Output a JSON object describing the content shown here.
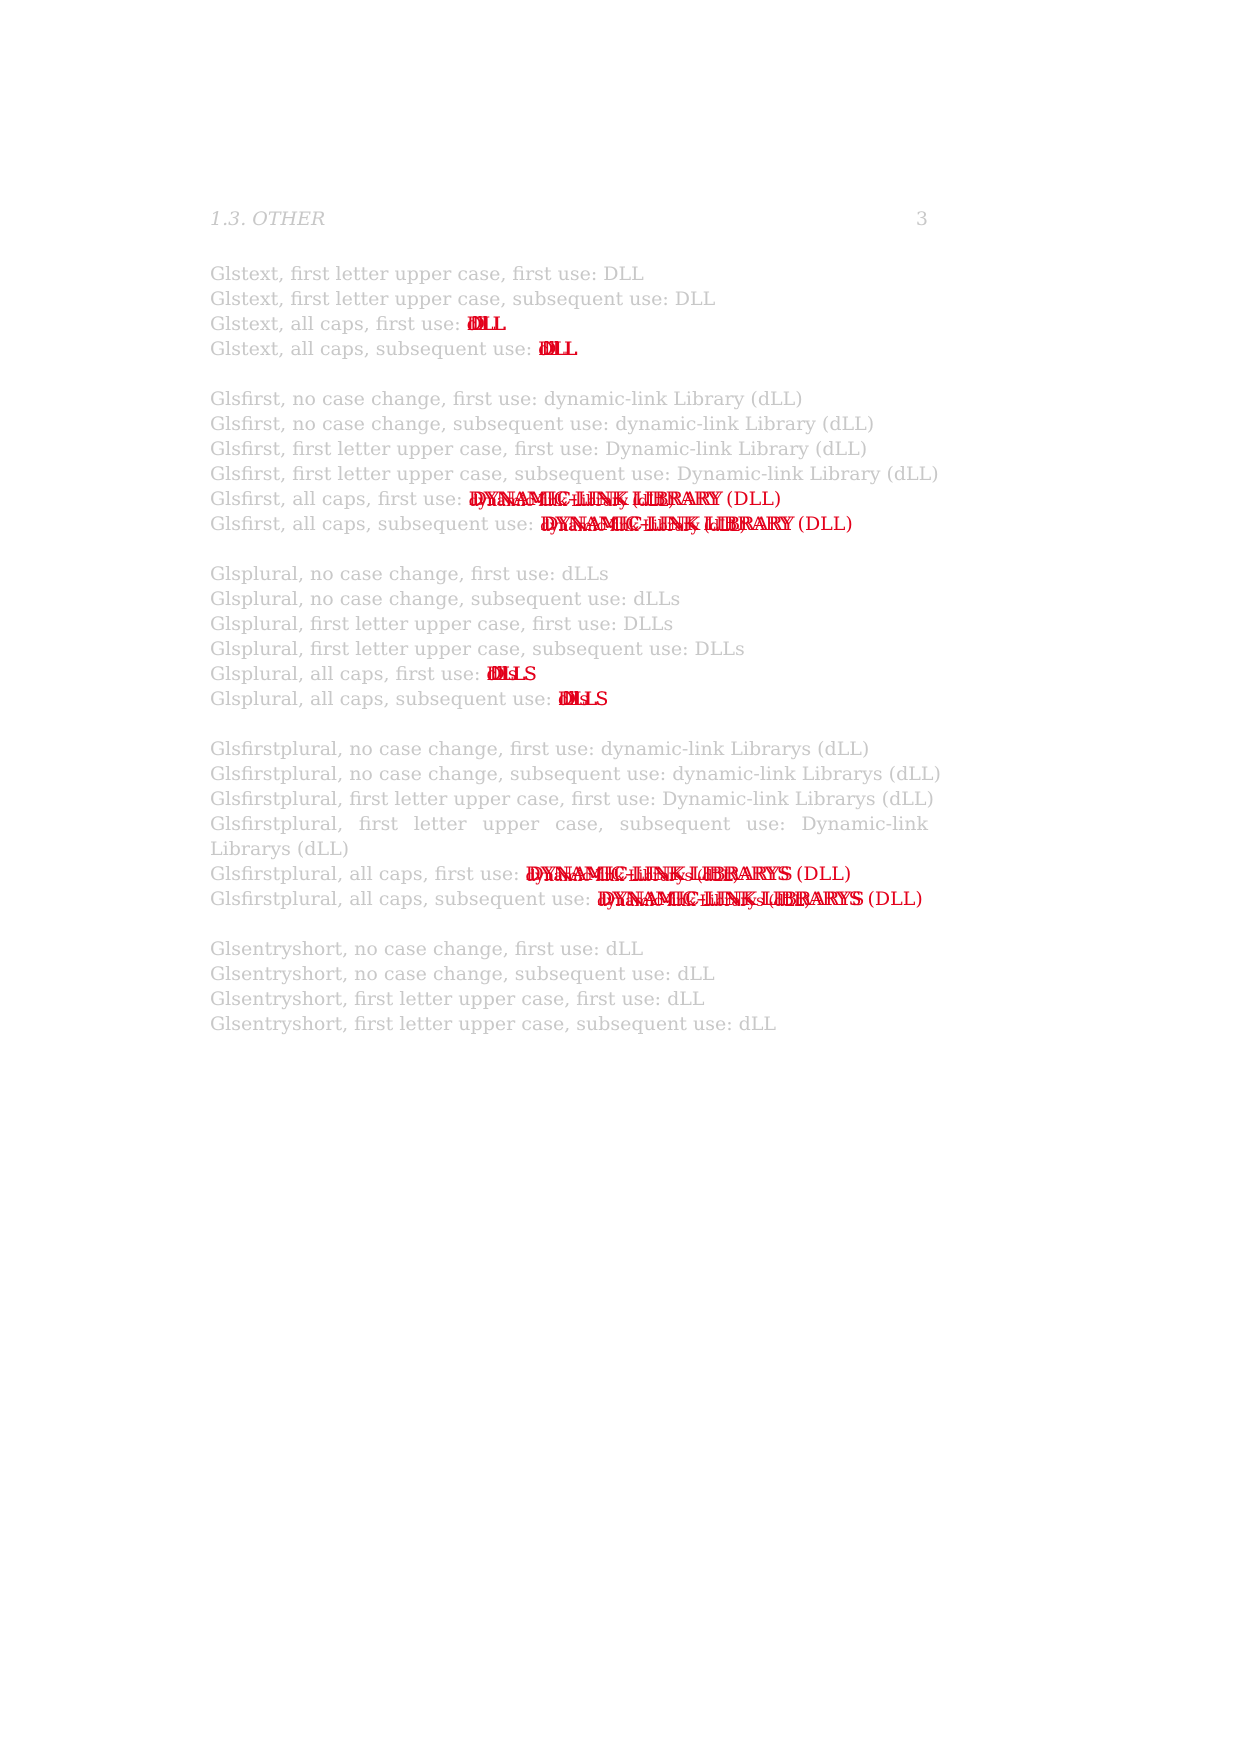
{
  "colors": {
    "text": "#c8c8c8",
    "highlight": "#e3001b"
  },
  "running_head": {
    "section": "1.3.   OTHER",
    "page_number": "3"
  },
  "paragraphs": [
    {
      "lines": [
        {
          "label": "Glstext, first letter upper case, first use: ",
          "value": "DLL"
        },
        {
          "label": "Glstext, first letter upper case, subsequent use: ",
          "value": "DLL"
        },
        {
          "label": "Glstext, all caps, first use: ",
          "overlay": [
            "dll",
            "DLL",
            "DLL"
          ]
        },
        {
          "label": "Glstext, all caps, subsequent use: ",
          "overlay": [
            "dll",
            "DLL",
            "DLL"
          ]
        }
      ]
    },
    {
      "lines": [
        {
          "label": "Glsfirst, no case change, first use: ",
          "value": "dynamic-link Library (dLL)"
        },
        {
          "label": "Glsfirst, no case change, subsequent use: ",
          "value": "dynamic-link Library (dLL)"
        },
        {
          "label": "Glsfirst, first letter upper case, first use: ",
          "value": "Dynamic-link Library (dLL)"
        },
        {
          "label": "Glsfirst, first letter upper case, subsequent use: ",
          "value": "Dynamic-link Library (dLL)"
        },
        {
          "label": "Glsfirst, all caps, first use: ",
          "overlay": [
            "dynamic-link Library (dLL)",
            "DYNAMIC-LINK LIBRARY",
            "DYNAMIC-LINK LIBRARY (DLL)"
          ]
        },
        {
          "label": "Glsfirst, all caps, subsequent use: ",
          "overlay": [
            "dynamic-link Library (dLL)",
            "DYNAMIC-LINK LIBRARY",
            "DYNAMIC-LINK LIBRARY (DLL)"
          ]
        }
      ]
    },
    {
      "lines": [
        {
          "label": "Glsplural, no case change, first use: ",
          "value": "dLLs"
        },
        {
          "label": "Glsplural, no case change, subsequent use: ",
          "value": "dLLs"
        },
        {
          "label": "Glsplural, first letter upper case, first use: ",
          "value": "DLLs"
        },
        {
          "label": "Glsplural, first letter upper case, subsequent use: ",
          "value": "DLLs"
        },
        {
          "label": "Glsplural, all caps, first use: ",
          "overlay": [
            "dlls",
            "DLLS",
            "DLLS"
          ]
        },
        {
          "label": "Glsplural, all caps, subsequent use: ",
          "overlay": [
            "dlls",
            "DLLS",
            "DLLS"
          ]
        }
      ]
    },
    {
      "lines": [
        {
          "label": "Glsfirstplural, no case change, first use: ",
          "value": "dynamic-link Librarys (dLL)"
        },
        {
          "label": "Glsfirstplural, no case change, subsequent use: ",
          "value": "dynamic-link Librarys (dLL)"
        },
        {
          "label": "Glsfirstplural, first letter upper case, first use: ",
          "value": "Dynamic-link Librarys (dLL)"
        },
        {
          "label": "Glsfirstplural, first letter upper case, subsequent use:  ",
          "value": "Dynamic-link Librarys (dLL)",
          "wrap": true
        },
        {
          "label": "Glsfirstplural, all caps, first use: ",
          "overlay": [
            "dynamic-link Librarys (dLL)",
            "DYNAMIC-LINK LIBRARYS",
            "DYNAMIC-LINK LIBRARYS (DLL)"
          ]
        },
        {
          "label": "Glsfirstplural, all caps, subsequent use: ",
          "overlay": [
            "dynamic-link Librarys (dLL)",
            "DYNAMIC-LINK LIBRARYS",
            "DYNAMIC-LINK LIBRARYS (DLL)"
          ]
        }
      ]
    },
    {
      "lines": [
        {
          "label": "Glsentryshort, no case change, first use: ",
          "value": "dLL"
        },
        {
          "label": "Glsentryshort, no case change, subsequent use: ",
          "value": "dLL"
        },
        {
          "label": "Glsentryshort, first letter upper case, first use: ",
          "value": "dLL"
        },
        {
          "label": "Glsentryshort, first letter upper case, subsequent use: ",
          "value": "dLL"
        }
      ]
    }
  ]
}
